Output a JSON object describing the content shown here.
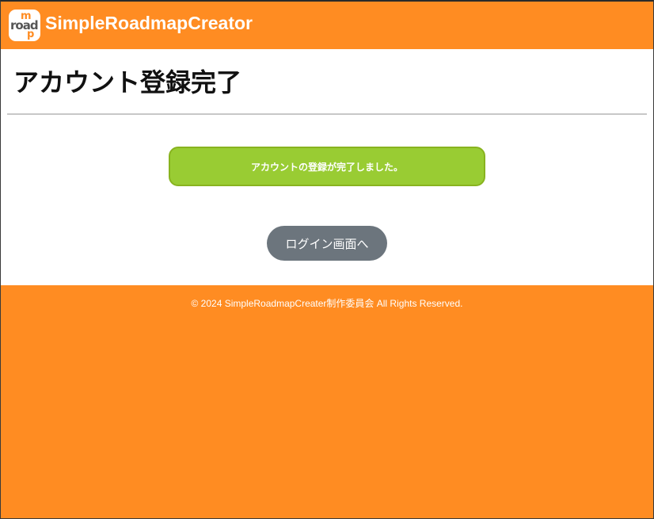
{
  "header": {
    "logo_letters": {
      "top": "m",
      "middle": "road",
      "bottom": "p"
    },
    "app_title": "SimpleRoadmapCreator"
  },
  "main": {
    "page_title": "アカウント登録完了",
    "alert_message": "アカウントの登録が完了しました。",
    "login_button_label": "ログイン画面へ"
  },
  "footer": {
    "copyright": "© 2024 SimpleRoadmapCreater制作委員会 All Rights Reserved."
  },
  "colors": {
    "brand_orange": "#ff8c22",
    "success_green": "#99cc33",
    "button_gray": "#6c757d",
    "divider": "#c8c8c8"
  }
}
